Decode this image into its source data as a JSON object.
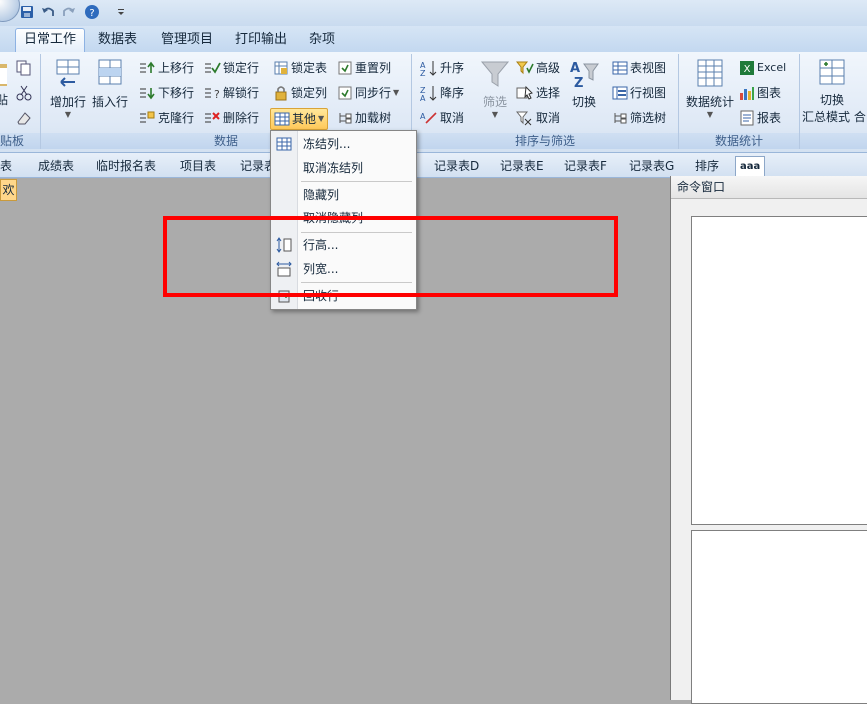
{
  "quick_access": {
    "icons": [
      "save-icon",
      "undo-icon",
      "redo-icon",
      "help-icon",
      "customize-icon"
    ]
  },
  "ribbon_tabs": [
    {
      "label": "日常工作",
      "active": true
    },
    {
      "label": "数据表"
    },
    {
      "label": "管理项目"
    },
    {
      "label": "打印输出"
    },
    {
      "label": "杂项"
    }
  ],
  "clipboard_group": {
    "label": "贴板",
    "paste": "贴"
  },
  "data_group": {
    "label": "数据",
    "add_row": "增加行",
    "insert_row": "插入行",
    "move_up": "上移行",
    "move_down": "下移行",
    "clone_row": "克隆行",
    "lock_row": "锁定行",
    "unlock_row": "解锁行",
    "delete_row": "删除行",
    "lock_table": "锁定表",
    "lock_column": "锁定列",
    "other": "其他",
    "reset_column": "重置列",
    "sync_row": "同步行",
    "load_tree": "加载树"
  },
  "sort_group": {
    "label": "排序与筛选",
    "asc": "升序",
    "desc": "降序",
    "cancel_sort": "取消",
    "filter": "筛选",
    "advanced": "高级",
    "select": "选择",
    "cancel_filter": "取消",
    "toggle": "切换",
    "table_view": "表视图",
    "row_view": "行视图",
    "filter_tree": "筛选树"
  },
  "stats_group": {
    "label": "数据统计",
    "data_stats": "数据统计",
    "excel": "Excel",
    "chart": "图表",
    "report": "报表"
  },
  "switch_group": {
    "line1": "切换",
    "line2": "汇总模式",
    "extra": "合"
  },
  "sheet_tabs": [
    "表",
    "成绩表",
    "临时报名表",
    "项目表",
    "记录表",
    "记录表D",
    "记录表E",
    "记录表F",
    "记录表G",
    "排序",
    "aaa"
  ],
  "left_cell": "欢",
  "menu": {
    "items": [
      {
        "label": "冻结列..."
      },
      {
        "label": "取消冻结列"
      },
      {
        "label": "隐藏列"
      },
      {
        "label": "取消隐藏列"
      },
      {
        "label": "行高..."
      },
      {
        "label": "列宽..."
      },
      {
        "label": "回收行"
      }
    ]
  },
  "command_window": {
    "title": "命令窗口"
  },
  "colors": {
    "highlight": "#ff0000",
    "accent": "#ffc95a",
    "workspace": "#ababab"
  }
}
